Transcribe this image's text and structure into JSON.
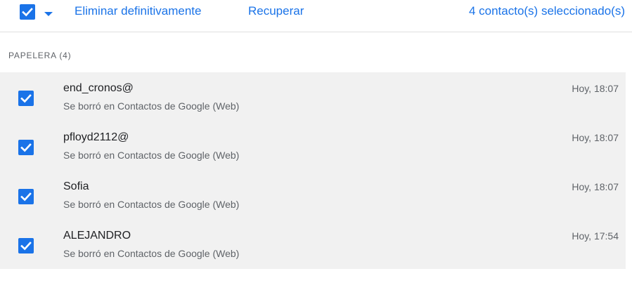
{
  "toolbar": {
    "delete_label": "Eliminar definitivamente",
    "recover_label": "Recuperar",
    "selected_count_label": "4 contacto(s) seleccionado(s)"
  },
  "section": {
    "title": "PAPELERA (4)"
  },
  "contacts": [
    {
      "name": "end_cronos@",
      "description": "Se borró en Contactos de Google (Web)",
      "time": "Hoy, 18:07",
      "checked": true
    },
    {
      "name": "pfloyd2112@",
      "description": "Se borró en Contactos de Google (Web)",
      "time": "Hoy, 18:07",
      "checked": true
    },
    {
      "name": "Sofia",
      "description": "Se borró en Contactos de Google (Web)",
      "time": "Hoy, 18:07",
      "checked": true
    },
    {
      "name": "ALEJANDRO",
      "description": "Se borró en Contactos de Google (Web)",
      "time": "Hoy, 17:54",
      "checked": true
    }
  ],
  "colors": {
    "accent": "#1a73e8",
    "row_background": "#f1f1f1",
    "secondary_text": "#5f6368"
  },
  "icons": {
    "master_checkbox": "checkbox-checked-icon",
    "dropdown": "arrow-drop-down-icon",
    "row_checkbox": "checkbox-checked-icon"
  }
}
